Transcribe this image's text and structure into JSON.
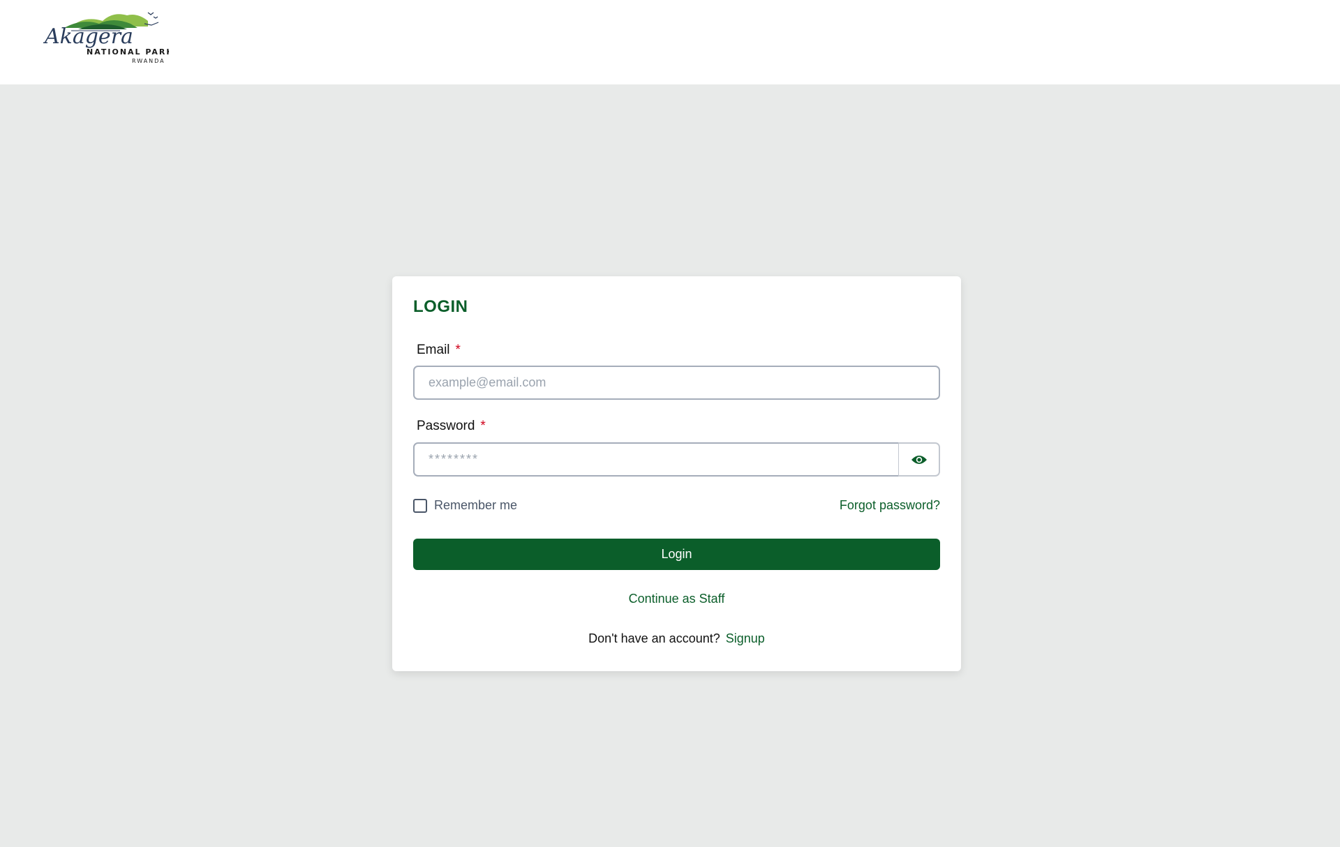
{
  "header": {
    "logo": {
      "script_text": "Akagera",
      "subtitle": "NATIONAL PARK",
      "country": "RWANDA"
    }
  },
  "login_card": {
    "title": "LOGIN",
    "email": {
      "label": "Email",
      "required_marker": "*",
      "placeholder": "example@email.com",
      "value": ""
    },
    "password": {
      "label": "Password",
      "required_marker": "*",
      "placeholder": "********",
      "value": "",
      "toggle_icon": "eye-icon"
    },
    "remember_me": {
      "label": "Remember me",
      "checked": false
    },
    "forgot_password": "Forgot password?",
    "login_button": "Login",
    "continue_staff": "Continue as Staff",
    "signup_prompt": "Don't have an account?",
    "signup_link": "Signup"
  },
  "colors": {
    "brand_green": "#0b5e2a",
    "background": "#e8eae9",
    "required_red": "#d0021b"
  }
}
